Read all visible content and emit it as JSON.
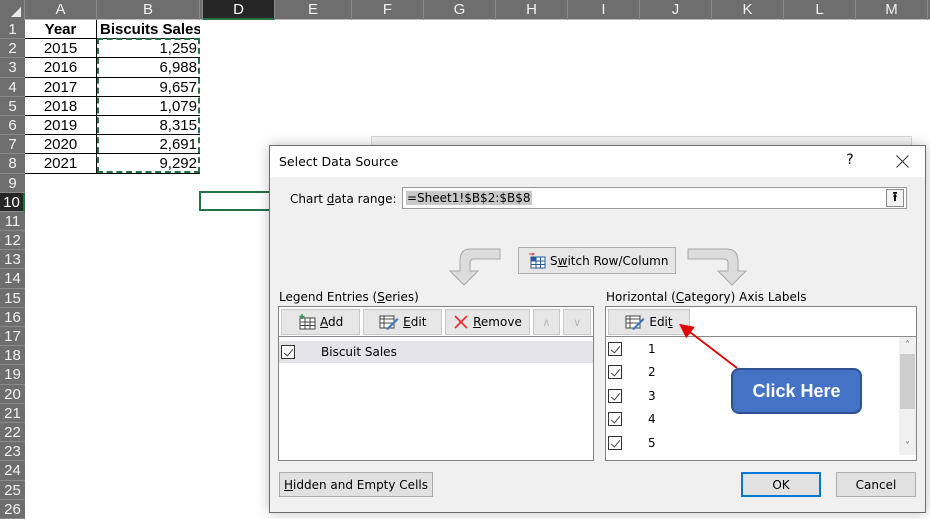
{
  "spreadsheet": {
    "columns": [
      "A",
      "B",
      "",
      "D",
      "E",
      "F",
      "G",
      "H",
      "I",
      "J",
      "K",
      "L",
      "M"
    ],
    "active_column": "D",
    "rows": [
      "1",
      "2",
      "3",
      "4",
      "5",
      "6",
      "7",
      "8",
      "9",
      "10",
      "11",
      "12",
      "13",
      "14",
      "15",
      "16",
      "17",
      "18",
      "19",
      "20",
      "21",
      "22",
      "23",
      "24",
      "25",
      "26"
    ],
    "active_row": "10",
    "table": {
      "headers": [
        "Year",
        "Biscuits Sales"
      ],
      "data": [
        [
          "2015",
          "1,259"
        ],
        [
          "2016",
          "6,988"
        ],
        [
          "2017",
          "9,657"
        ],
        [
          "2018",
          "1,079"
        ],
        [
          "2019",
          "8,315"
        ],
        [
          "2020",
          "2,691"
        ],
        [
          "2021",
          "9,292"
        ]
      ]
    },
    "accent_color": "#217346"
  },
  "dialog": {
    "title": "Select Data Source",
    "help_label": "?",
    "chart_data_range": {
      "label_pre": "Chart ",
      "label_ul": "d",
      "label_post": "ata range:",
      "value": "=Sheet1!$B$2:$B$8"
    },
    "switch_button": {
      "pre": "S",
      "ul": "w",
      "post": "itch Row/Column"
    },
    "legend_entries": {
      "label_pre": "Legend Entries (",
      "label_ul": "S",
      "label_post": "eries)",
      "add_ul": "A",
      "add_post": "dd",
      "edit_ul": "E",
      "edit_post": "dit",
      "remove_ul": "R",
      "remove_post": "emove",
      "series": [
        {
          "name": "Biscuit Sales",
          "checked": true
        }
      ]
    },
    "axis_labels": {
      "label_pre": "Horizontal (",
      "label_ul": "C",
      "label_post": "ategory) Axis Labels",
      "edit_pre": "Edi",
      "edit_ul": "t",
      "items": [
        {
          "label": "1",
          "checked": true
        },
        {
          "label": "2",
          "checked": true
        },
        {
          "label": "3",
          "checked": true
        },
        {
          "label": "4",
          "checked": true
        },
        {
          "label": "5",
          "checked": true
        }
      ]
    },
    "hidden_cells": {
      "ul": "H",
      "post": "idden and Empty Cells"
    },
    "ok_label": "OK",
    "cancel_label": "Cancel"
  },
  "annotation": {
    "callout_text": "Click Here",
    "callout_color": "#4472c4",
    "arrow_color": "#e00000"
  }
}
